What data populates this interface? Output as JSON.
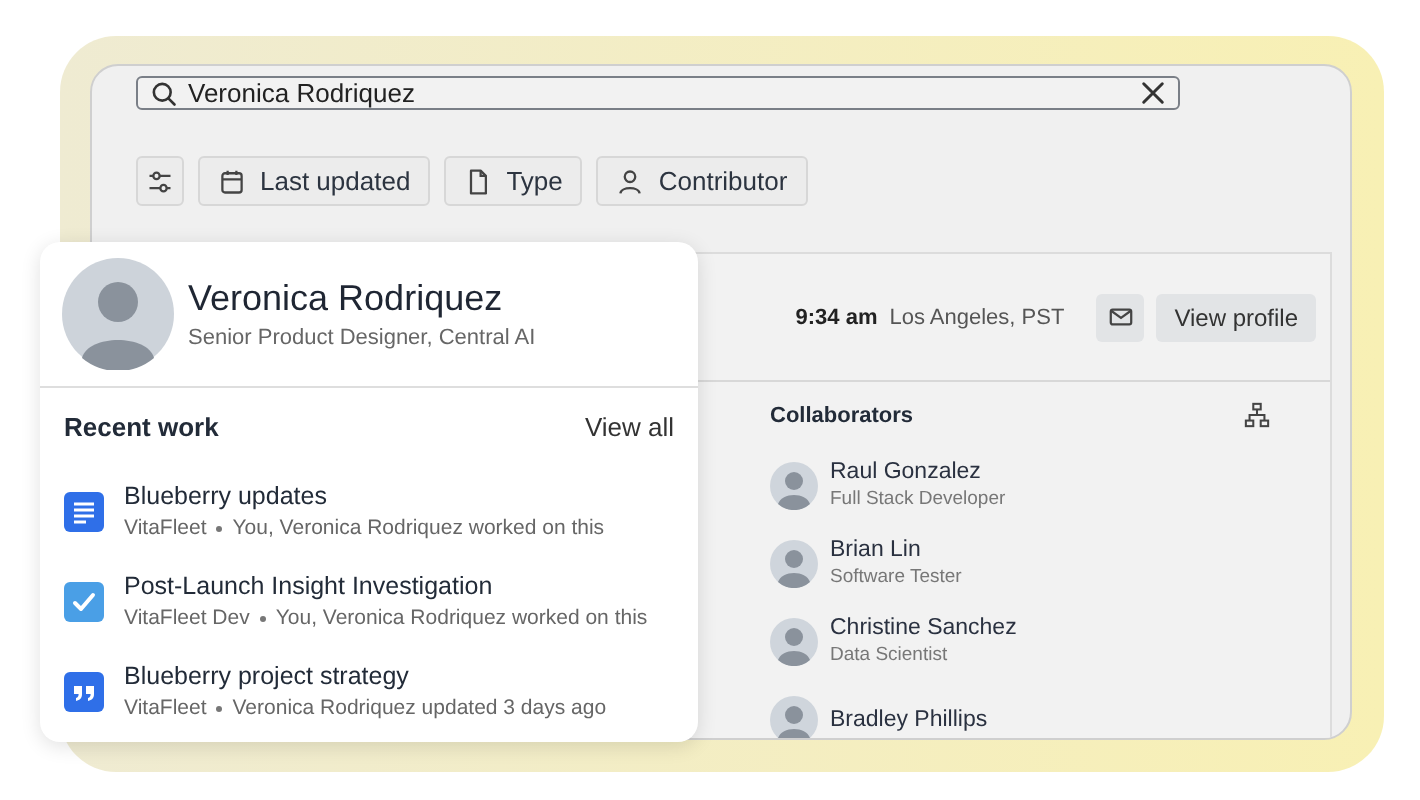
{
  "search": {
    "value": "Veronica Rodriquez"
  },
  "filters": [
    {
      "label": "Last updated"
    },
    {
      "label": "Type"
    },
    {
      "label": "Contributor"
    }
  ],
  "profile": {
    "name": "Veronica Rodriquez",
    "title": "Senior Product Designer, Central AI",
    "local_time": "9:34 am",
    "location": "Los Angeles, PST",
    "view_profile": "View profile"
  },
  "recent_work": {
    "heading": "Recent work",
    "view_all": "View all",
    "items": [
      {
        "kind": "document",
        "title": "Blueberry updates",
        "space": "VitaFleet",
        "activity": "You, Veronica Rodriquez worked on this"
      },
      {
        "kind": "task",
        "title": "Post-Launch Insight Investigation",
        "space": "VitaFleet Dev",
        "activity": "You, Veronica Rodriquez worked on this"
      },
      {
        "kind": "quote",
        "title": "Blueberry project strategy",
        "space": "VitaFleet",
        "activity": "Veronica Rodriquez updated 3 days ago"
      }
    ]
  },
  "collaborators": {
    "heading": "Collaborators",
    "people": [
      {
        "name": "Raul Gonzalez",
        "role": "Full Stack Developer"
      },
      {
        "name": "Brian Lin",
        "role": "Software Tester"
      },
      {
        "name": "Christine Sanchez",
        "role": "Data Scientist"
      },
      {
        "name": "Bradley Phillips"
      }
    ]
  }
}
